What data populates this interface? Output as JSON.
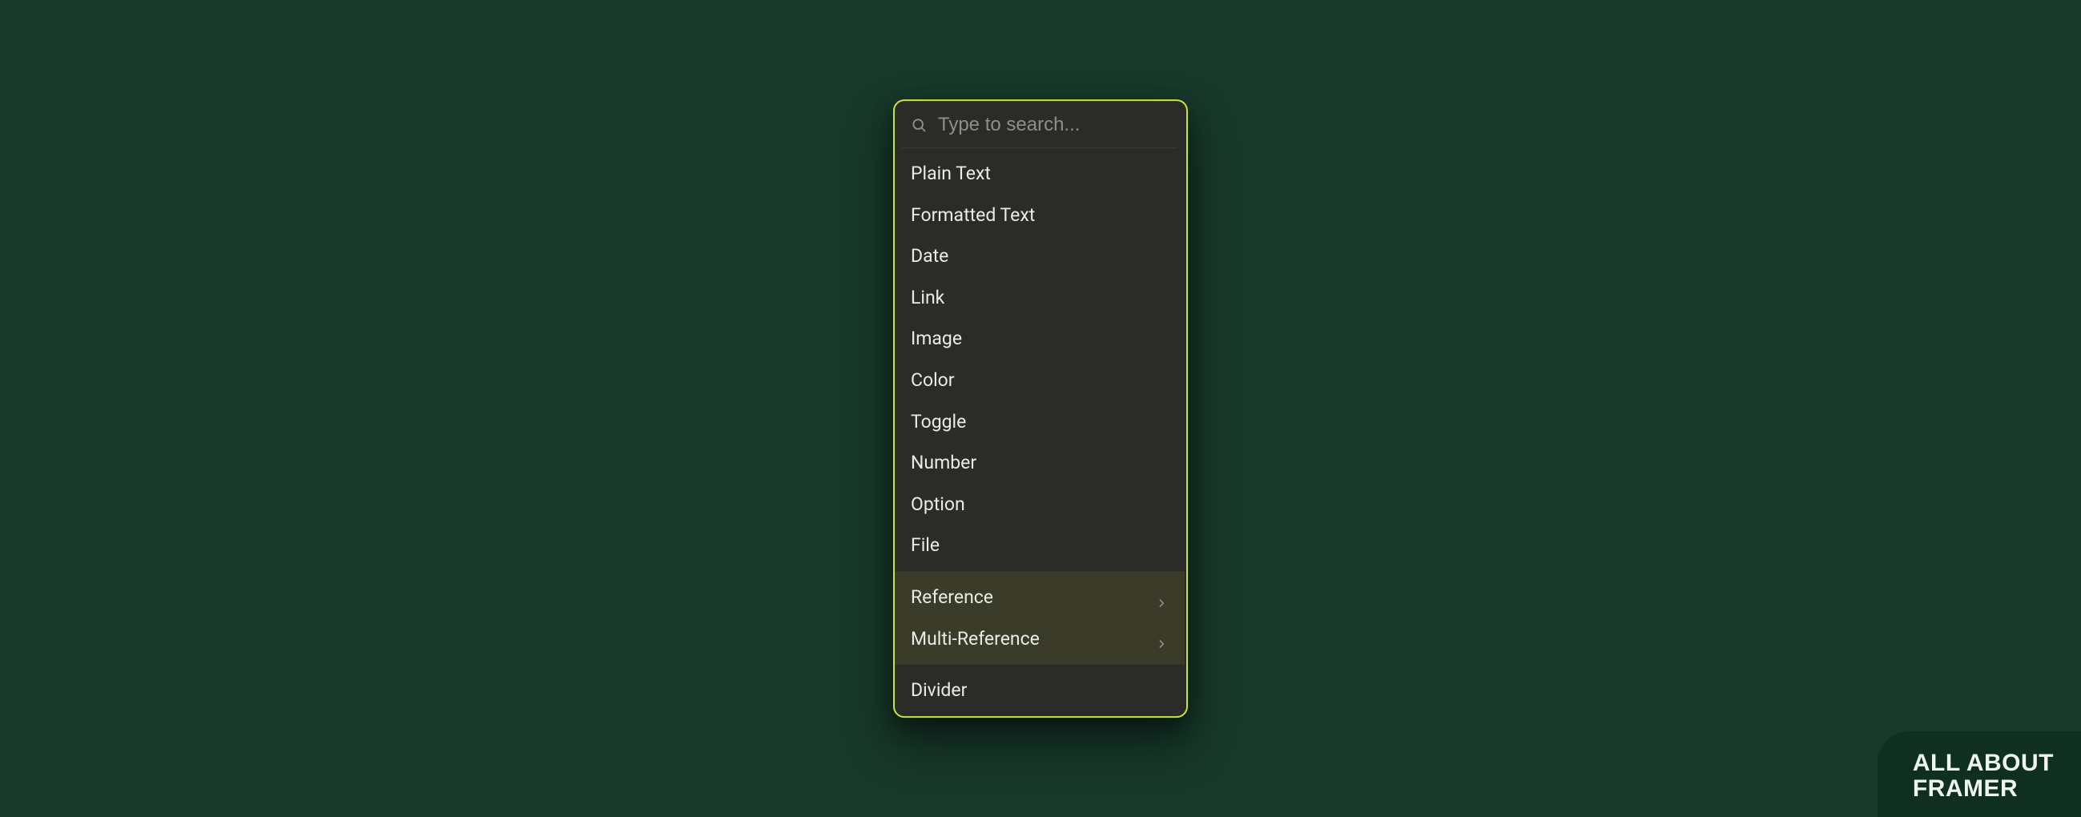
{
  "search": {
    "placeholder": "Type to search..."
  },
  "groups": {
    "primary": [
      {
        "label": "Plain Text"
      },
      {
        "label": "Formatted Text"
      },
      {
        "label": "Date"
      },
      {
        "label": "Link"
      },
      {
        "label": "Image"
      },
      {
        "label": "Color"
      },
      {
        "label": "Toggle"
      },
      {
        "label": "Number"
      },
      {
        "label": "Option"
      },
      {
        "label": "File"
      }
    ],
    "reference": [
      {
        "label": "Reference",
        "submenu": true
      },
      {
        "label": "Multi-Reference",
        "submenu": true
      }
    ],
    "extra": [
      {
        "label": "Divider"
      }
    ]
  },
  "brand": {
    "line1": "ALL ABOUT",
    "line2": "FRAMER"
  },
  "colors": {
    "background": "#17382a",
    "panel": "#2b2b28",
    "accent_border": "#c5e838",
    "highlight_group": "#3b3b2a",
    "brand_tab": "#0f2f21"
  }
}
